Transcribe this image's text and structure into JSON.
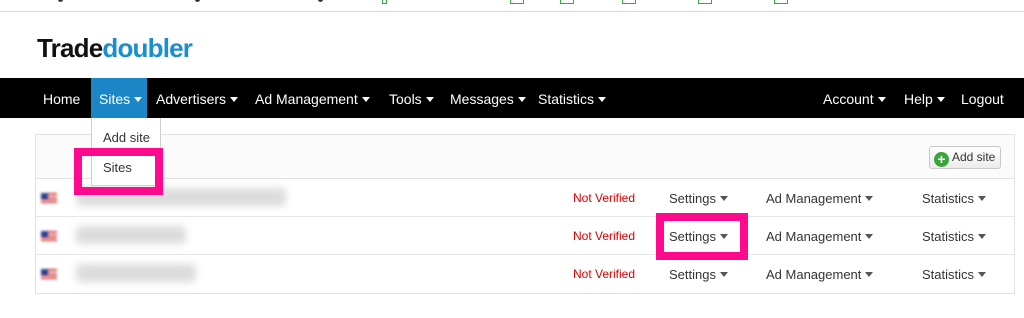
{
  "brand": {
    "logo_part1": "Trade",
    "logo_part2": "doubler",
    "accent_color": "#1b86c6",
    "highlight_color": "#ff0a8c"
  },
  "nav": {
    "left": [
      {
        "label": "Home",
        "has_caret": false
      },
      {
        "label": "Sites",
        "has_caret": true,
        "active": true
      },
      {
        "label": "Advertisers",
        "has_caret": true
      },
      {
        "label": "Ad Management",
        "has_caret": true
      },
      {
        "label": "Tools",
        "has_caret": true
      },
      {
        "label": "Messages",
        "has_caret": true
      },
      {
        "label": "Statistics",
        "has_caret": true
      }
    ],
    "right": [
      {
        "label": "Account",
        "has_caret": true
      },
      {
        "label": "Help",
        "has_caret": true
      },
      {
        "label": "Logout",
        "has_caret": false
      }
    ]
  },
  "sites_dropdown": {
    "items": [
      "Add site",
      "Sites"
    ]
  },
  "panel": {
    "add_site_label": "Add site",
    "add_site_icon": "plus-circle-icon",
    "rows": [
      {
        "status": "Not Verified",
        "settings": "Settings",
        "ad_management": "Ad Management",
        "statistics": "Statistics"
      },
      {
        "status": "Not Verified",
        "settings": "Settings",
        "ad_management": "Ad Management",
        "statistics": "Statistics"
      },
      {
        "status": "Not Verified",
        "settings": "Settings",
        "ad_management": "Ad Management",
        "statistics": "Statistics"
      }
    ]
  }
}
